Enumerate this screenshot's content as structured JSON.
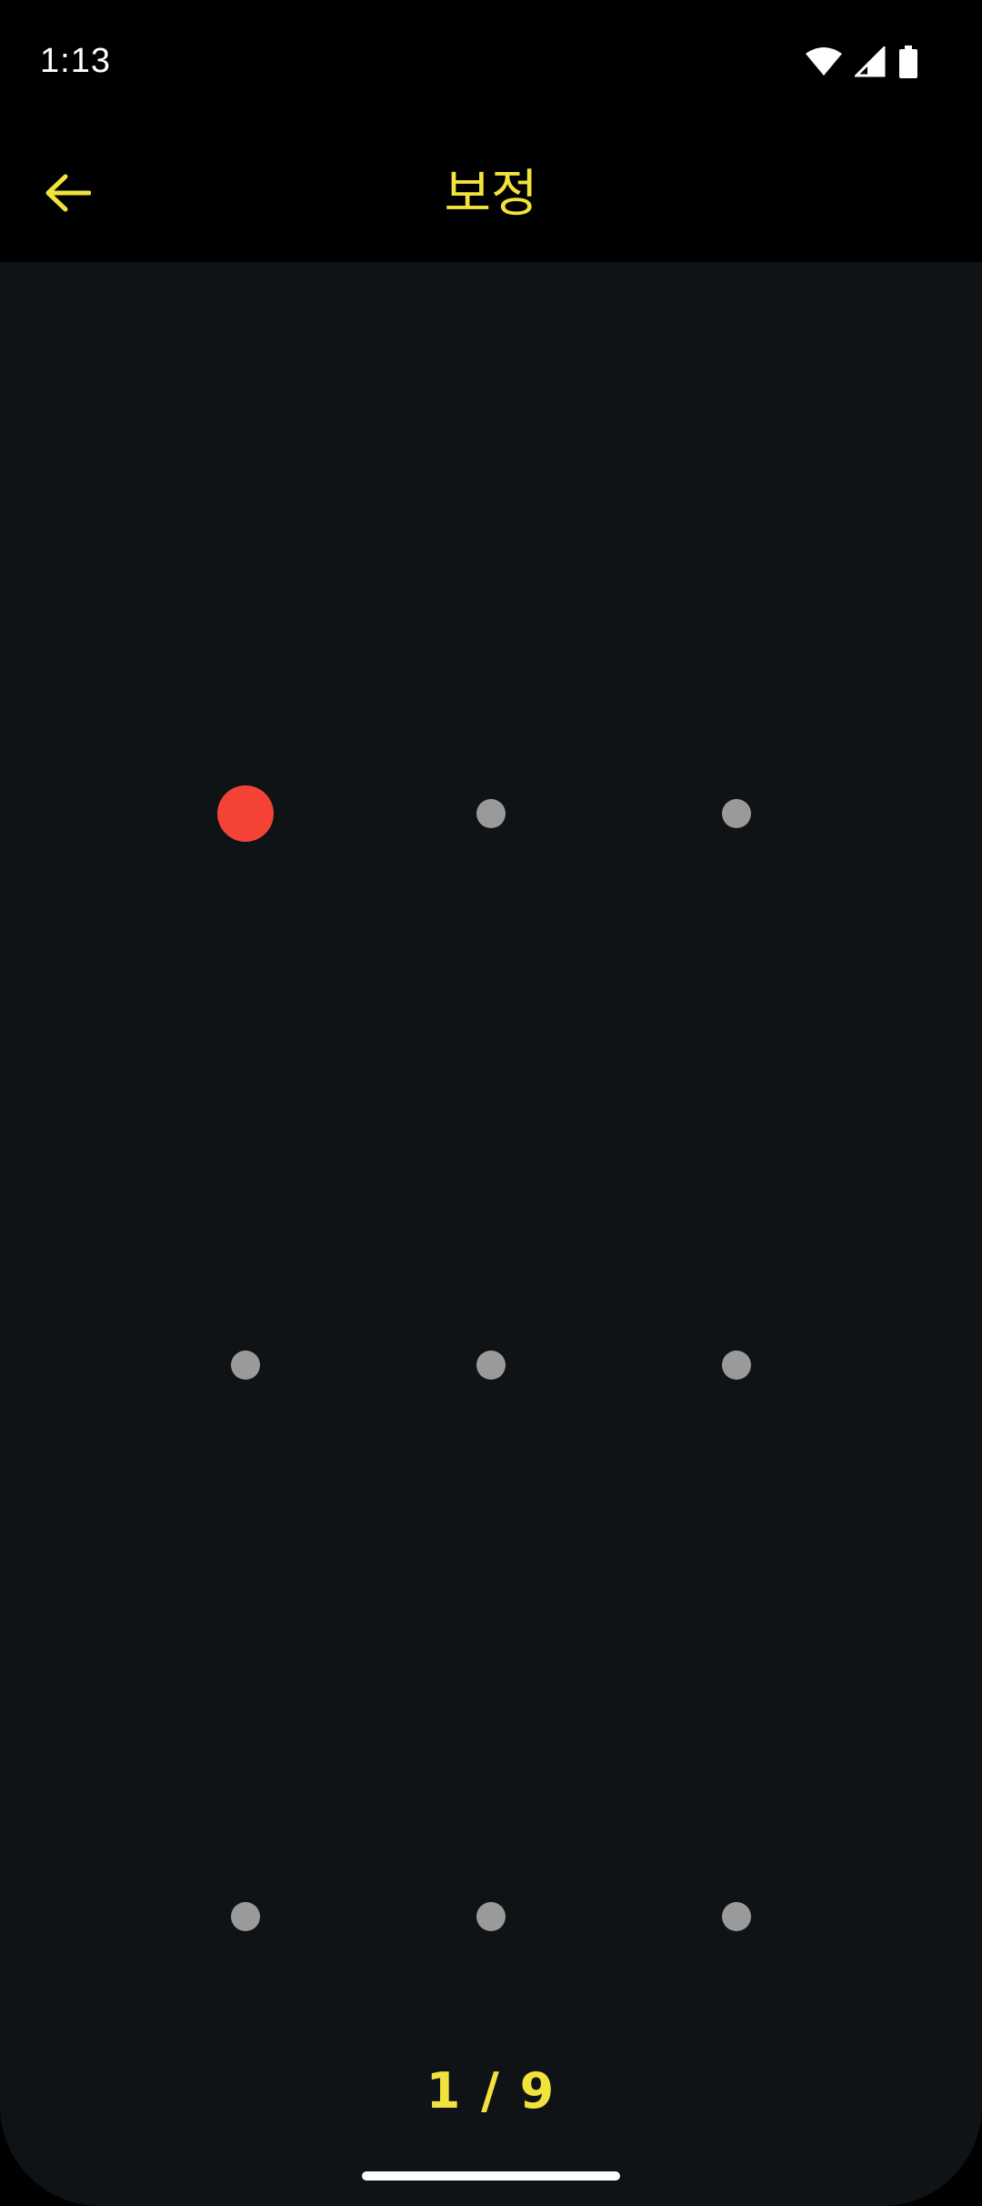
{
  "status_bar": {
    "time": "1:13",
    "icons": [
      "wifi-icon",
      "cellular-signal-icon",
      "battery-icon"
    ]
  },
  "app_bar": {
    "title": "보정",
    "back_icon": "arrow-left-icon"
  },
  "calibration": {
    "active_index": 0,
    "points": [
      {
        "row": 0,
        "col": 0,
        "state": "active"
      },
      {
        "row": 0,
        "col": 1,
        "state": "pending"
      },
      {
        "row": 0,
        "col": 2,
        "state": "pending"
      },
      {
        "row": 1,
        "col": 0,
        "state": "pending"
      },
      {
        "row": 1,
        "col": 1,
        "state": "pending"
      },
      {
        "row": 1,
        "col": 2,
        "state": "pending"
      },
      {
        "row": 2,
        "col": 0,
        "state": "pending"
      },
      {
        "row": 2,
        "col": 1,
        "state": "pending"
      },
      {
        "row": 2,
        "col": 2,
        "state": "pending"
      }
    ],
    "progress_text": "1 / 9"
  },
  "colors": {
    "accent": "#f2e33c",
    "active_point": "#f44336",
    "pending_point": "#9a9a9a",
    "background": "#0f1316"
  }
}
